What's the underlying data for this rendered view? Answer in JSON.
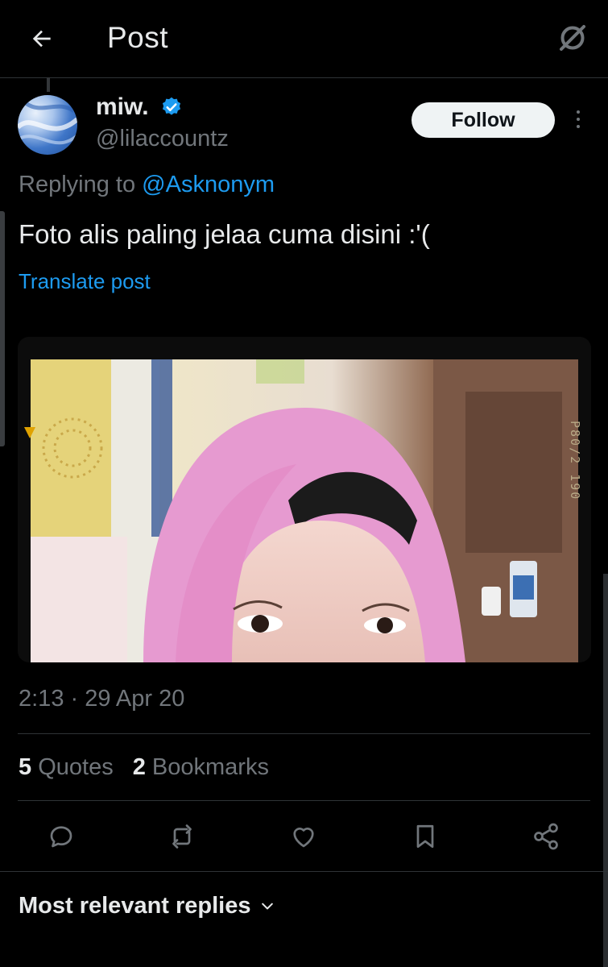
{
  "header": {
    "title": "Post"
  },
  "author": {
    "name": "miw.",
    "handle": "@lilaccountz",
    "follow_label": "Follow"
  },
  "reply": {
    "prefix": "Replying to",
    "to_handle": "@Asknonym"
  },
  "tweet": {
    "text": "Foto alis paling jelaa cuma disini :'(",
    "translate_label": "Translate post"
  },
  "media": {
    "film_code": "P80/2 190"
  },
  "meta": {
    "timestamp": "2:13 · 29 Apr 20"
  },
  "stats": {
    "quotes_count": "5",
    "quotes_label": "Quotes",
    "bookmarks_count": "2",
    "bookmarks_label": "Bookmarks"
  },
  "replies_sort": {
    "label": "Most relevant replies"
  },
  "colors": {
    "accent": "#1d9bf0",
    "background": "#000000",
    "secondary_text": "#71767b"
  },
  "icons": [
    "back-arrow-icon",
    "grok-icon",
    "verified-badge-icon",
    "more-icon",
    "reply-icon",
    "repost-icon",
    "like-icon",
    "bookmark-icon",
    "share-icon",
    "chevron-down-icon"
  ]
}
